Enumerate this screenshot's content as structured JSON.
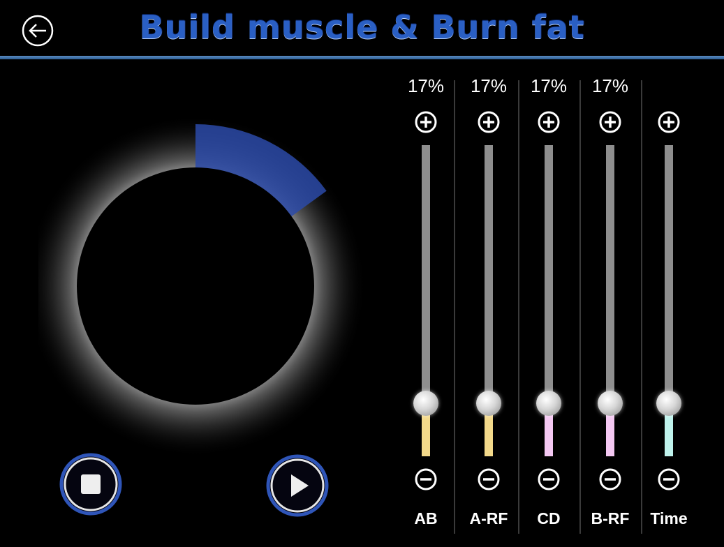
{
  "header": {
    "title": "Build muscle & Burn fat",
    "back_icon": "back-arrow-icon",
    "accent_color": "#2d5f96"
  },
  "dial": {
    "progress_percent": 15,
    "progress_color": "#2b4aa8",
    "ring_color": "#9a9a9a"
  },
  "controls": {
    "stop_icon": "stop-icon",
    "play_icon": "play-icon"
  },
  "channels": [
    {
      "name": "AB",
      "percent": "17%",
      "level": 0.17,
      "fill_color": "#f3d98a"
    },
    {
      "name": "A-RF",
      "percent": "17%",
      "level": 0.17,
      "fill_color": "#f3d98a"
    },
    {
      "name": "CD",
      "percent": "17%",
      "level": 0.17,
      "fill_color": "#f4c8f2"
    },
    {
      "name": "B-RF",
      "percent": "17%",
      "level": 0.17,
      "fill_color": "#f4c8f2"
    },
    {
      "name": "Time",
      "percent": "",
      "level": 0.17,
      "fill_color": "#bff2ec"
    }
  ]
}
